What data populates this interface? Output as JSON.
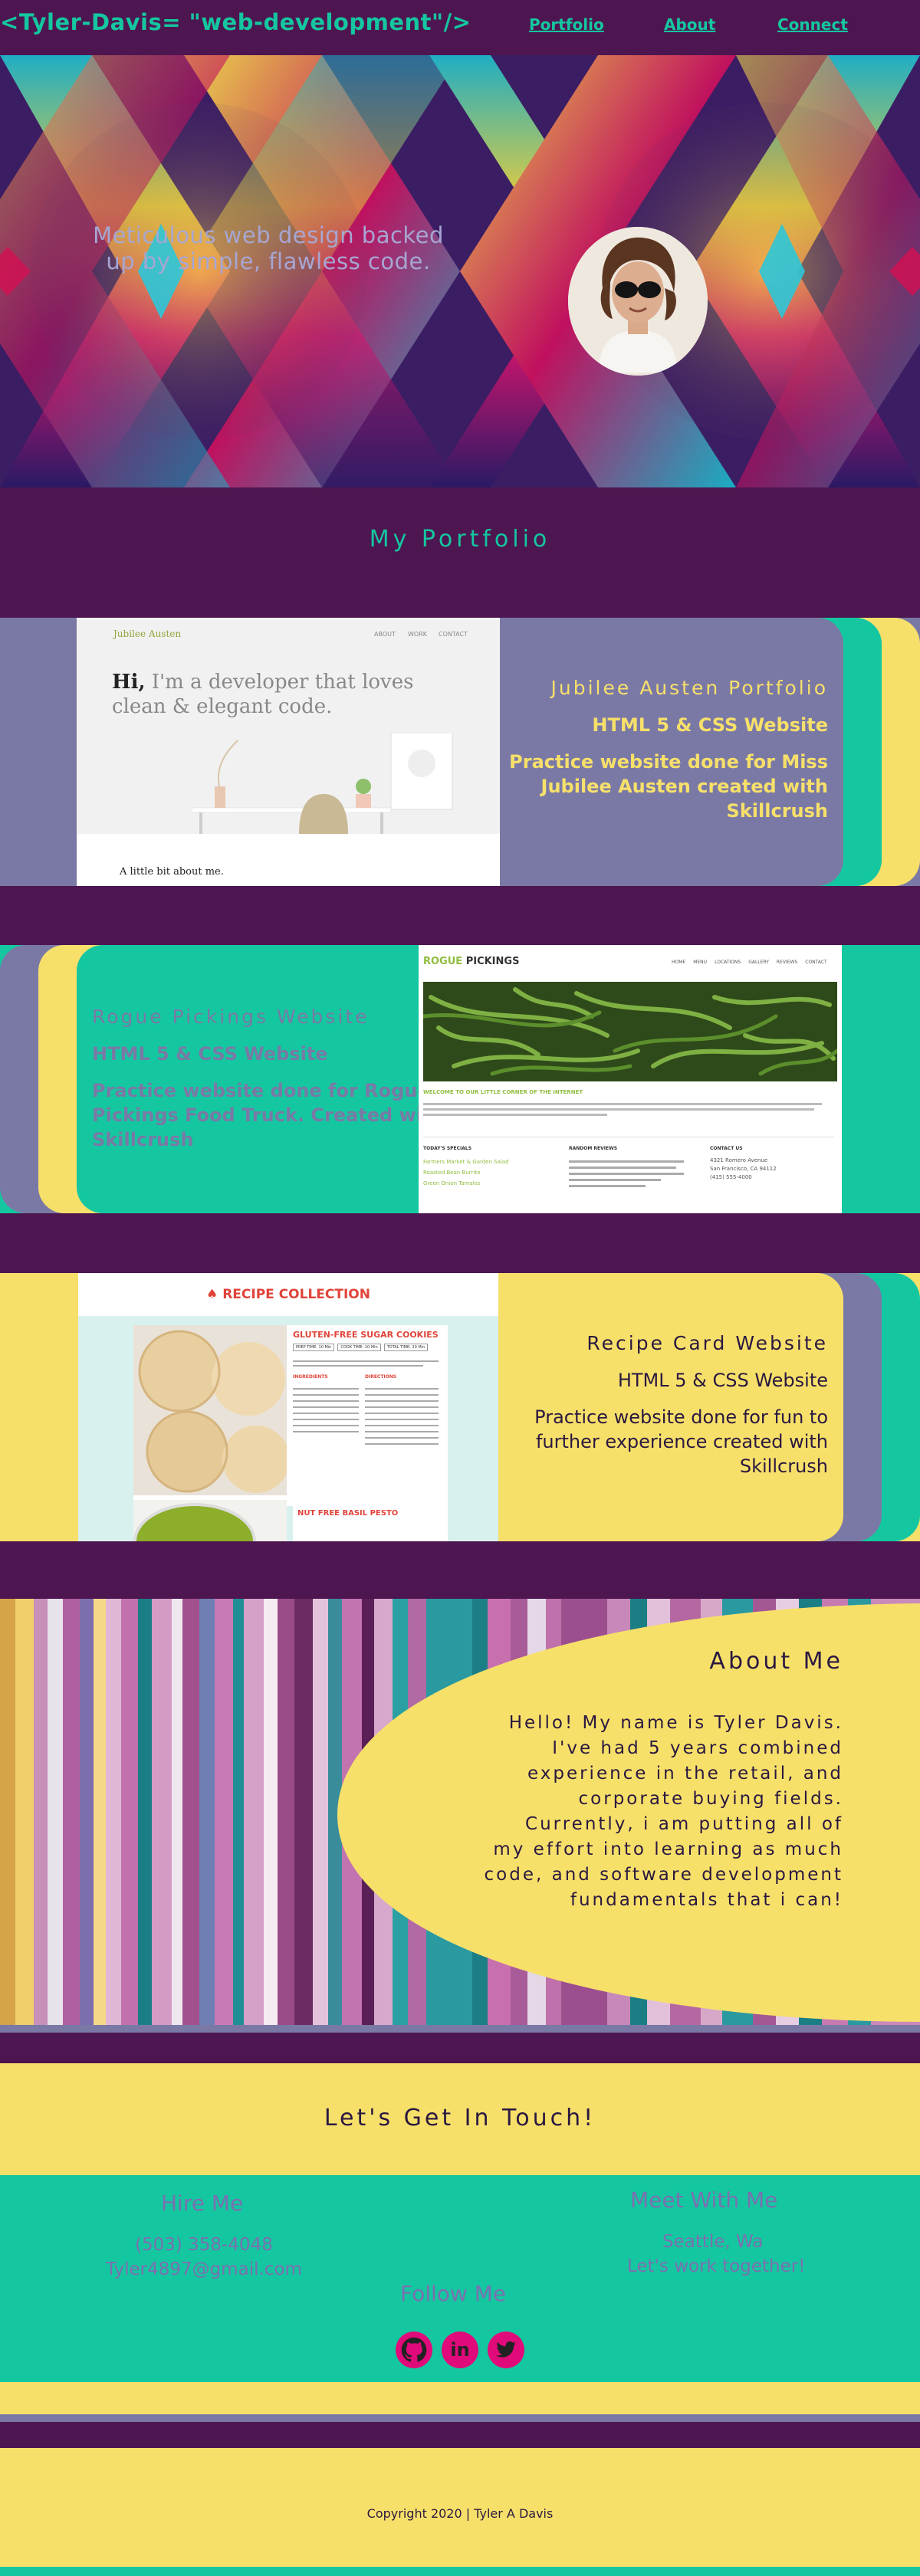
{
  "header": {
    "logo": "<Tyler-Davis= \"web-development\"/>",
    "nav": [
      {
        "label": "Portfolio"
      },
      {
        "label": "About"
      },
      {
        "label": "Connect"
      }
    ]
  },
  "hero": {
    "tagline_line1": "Meticulous web design backed",
    "tagline_line2": "up by simple, flawless code."
  },
  "portfolio": {
    "title": "My Portfolio",
    "projects": [
      {
        "title": "Jubilee Austen Portfolio",
        "tech": "HTML 5 & CSS  Website",
        "desc_lines": [
          "Practice website done for Miss",
          "Jubilee Austen created with",
          "Skillcrush"
        ],
        "shot": {
          "brand": "Jubilee Austen",
          "nav": [
            "ABOUT",
            "WORK",
            "CONTACT"
          ],
          "heading_bold": "Hi,",
          "heading_rest_line1": "I'm a developer that loves",
          "heading_line2": "clean & elegant code.",
          "footer": "A little bit about me."
        }
      },
      {
        "title": "Rogue Pickings Website",
        "tech": "HTML 5 & CSS  Website",
        "desc_lines": [
          "Practice website done for Rogue",
          "Pickings Food Truck. Created with",
          "Skillcrush"
        ],
        "shot": {
          "brand_accent": "ROGUE",
          "brand_rest": " PICKINGS",
          "nav": [
            "HOME",
            "MENU",
            "LOCATIONS",
            "GALLERY",
            "REVIEWS",
            "CONTACT"
          ],
          "welcome": "WELCOME TO OUR LITTLE CORNER OF THE INTERNET",
          "col1_head": "TODAY'S SPECIALS",
          "col1_items": [
            "Farmers Market & Garden Salad",
            "Roasted Bean Burrito",
            "Green Onion Tamales"
          ],
          "col2_head": "RANDOM REVIEWS",
          "col3_head": "CONTACT US",
          "col3_lines": [
            "4321 Romero Avenue",
            "San Francisco, CA 94112",
            "(415) 555-4000"
          ]
        }
      },
      {
        "title": "Recipe Card Website",
        "tech": "HTML 5 & CSS  Website",
        "desc_lines": [
          "Practice website done for fun to",
          "further experience created with",
          "Skillcrush"
        ],
        "shot": {
          "header": "RECIPE COLLECTION",
          "card1": "GLUTEN-FREE SUGAR COOKIES",
          "card1_tags": [
            "PREP TIME: 10 Min",
            "COOK TIME: 10 Min",
            "TOTAL TIME: 20 Min"
          ],
          "ingredients": "INGREDIENTS",
          "directions": "DIRECTIONS",
          "card2": "NUT FREE BASIL PESTO"
        }
      }
    ]
  },
  "about": {
    "title": "About Me",
    "lines": [
      "Hello! My name is Tyler Davis.",
      "I've had 5 years combined",
      "experience in the retail, and",
      "corporate buying fields.",
      "Currently, i am putting all of",
      "my effort into learning as much",
      "code, and software development",
      "fundamentals that i can!"
    ]
  },
  "contact": {
    "title": "Let's Get In Touch!",
    "hire_heading": "Hire Me",
    "phone": "(503) 358-4048",
    "email": "Tyler4897@gmail.com",
    "meet_heading": "Meet With Me",
    "city": "Seattle, Wa",
    "tagline": "Let's work together!",
    "follow_heading": "Follow Me",
    "socials": [
      {
        "icon": "github-icon"
      },
      {
        "icon": "linkedin-icon",
        "text": "in"
      },
      {
        "icon": "twitter-icon"
      }
    ]
  },
  "footer": {
    "copyright": "Copyright 2020 | Tyler A Davis"
  },
  "colors": {
    "plum": "#4e1650",
    "teal": "#14c7a0",
    "yellow": "#f7e06a",
    "periwinkle": "#7a79a6",
    "pink": "#e10a7a"
  }
}
